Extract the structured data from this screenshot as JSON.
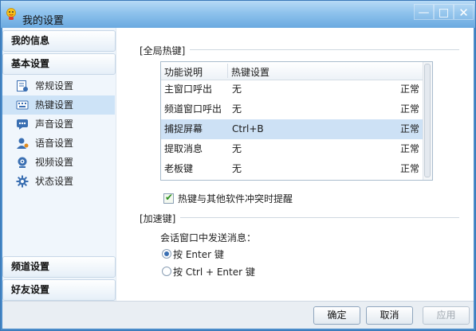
{
  "window": {
    "title": "我的设置",
    "minimize_glyph": "—",
    "maximize_glyph": "□",
    "close_glyph": "✕"
  },
  "sidebar": {
    "headers": [
      "我的信息",
      "基本设置",
      "频道设置",
      "好友设置"
    ],
    "items": [
      {
        "label": "常规设置",
        "icon": "general-settings-icon"
      },
      {
        "label": "热键设置",
        "icon": "hotkey-icon",
        "active": true
      },
      {
        "label": "声音设置",
        "icon": "sound-icon"
      },
      {
        "label": "语音设置",
        "icon": "voice-icon"
      },
      {
        "label": "视频设置",
        "icon": "video-icon"
      },
      {
        "label": "状态设置",
        "icon": "status-gear-icon"
      }
    ]
  },
  "global_hotkeys": {
    "section_title": "[全局热键]",
    "columns": [
      "功能说明",
      "热键设置"
    ],
    "rows": [
      {
        "function": "主窗口呼出",
        "hotkey": "无",
        "status": "正常"
      },
      {
        "function": "频道窗口呼出",
        "hotkey": "无",
        "status": "正常"
      },
      {
        "function": "捕捉屏幕",
        "hotkey": "Ctrl+B",
        "status": "正常",
        "selected": true
      },
      {
        "function": "提取消息",
        "hotkey": "无",
        "status": "正常"
      },
      {
        "function": "老板键",
        "hotkey": "无",
        "status": "正常"
      }
    ],
    "conflict_checkbox_label": "热键与其他软件冲突时提醒",
    "conflict_checked": true
  },
  "accelerator": {
    "section_title": "[加速键]",
    "send_label": "会话窗口中发送消息：",
    "options": [
      {
        "label": "按 Enter 键",
        "selected": true
      },
      {
        "label": "按 Ctrl + Enter 键",
        "selected": false
      }
    ]
  },
  "buttons": {
    "ok": "确定",
    "cancel": "取消",
    "apply": "应用"
  },
  "colors": {
    "titlebar": "#8ec2ec",
    "selection": "#cde3f7",
    "accent": "#3a6fb2"
  }
}
